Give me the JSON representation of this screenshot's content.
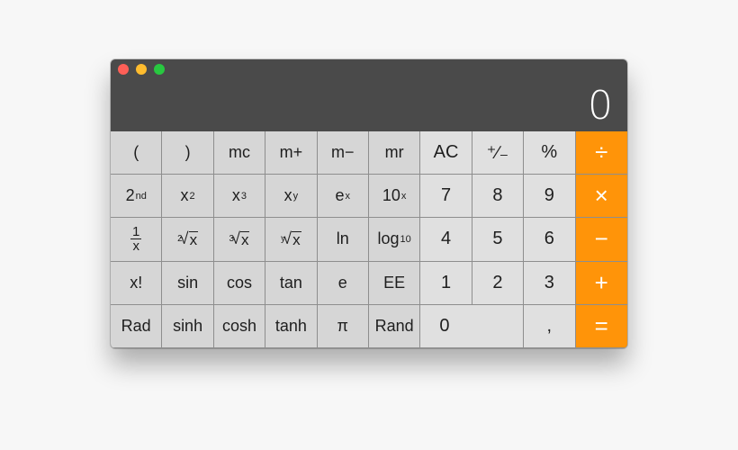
{
  "window": {
    "traffic_lights": [
      "close",
      "minimize",
      "zoom"
    ]
  },
  "display": {
    "value": "0"
  },
  "colors": {
    "operator": "#ff9409",
    "function_key": "#d6d6d6",
    "digit_key": "#e0e0e0",
    "display_bg": "#4a4a4a"
  },
  "keys": {
    "row1": {
      "open_paren": "(",
      "close_paren": ")",
      "mc": "mc",
      "m_plus": "m+",
      "m_minus": "m−",
      "mr": "mr",
      "ac": "AC",
      "sign": "⁺∕₋",
      "percent": "%",
      "divide": "÷"
    },
    "row2": {
      "second_base": "2",
      "second_sup": "nd",
      "x_squared_base": "x",
      "x_squared_sup": "2",
      "x_cubed_base": "x",
      "x_cubed_sup": "3",
      "x_pow_y_base": "x",
      "x_pow_y_sup": "y",
      "e_pow_x_base": "e",
      "e_pow_x_sup": "x",
      "ten_pow_x_base": "10",
      "ten_pow_x_sup": "x",
      "seven": "7",
      "eight": "8",
      "nine": "9",
      "multiply": "×"
    },
    "row3": {
      "reciprocal_num": "1",
      "reciprocal_den": "x",
      "sqrt2_index": "2",
      "sqrt2_symbol": "√",
      "sqrt2_radicand": "x",
      "sqrt3_index": "3",
      "sqrt3_symbol": "√",
      "sqrt3_radicand": "x",
      "sqrty_index": "y",
      "sqrty_symbol": "√",
      "sqrty_radicand": "x",
      "ln": "ln",
      "log10_base": "log",
      "log10_sub": "10",
      "four": "4",
      "five": "5",
      "six": "6",
      "minus": "−"
    },
    "row4": {
      "factorial": "x!",
      "sin": "sin",
      "cos": "cos",
      "tan": "tan",
      "e": "e",
      "ee": "EE",
      "one": "1",
      "two": "2",
      "three": "3",
      "plus": "+"
    },
    "row5": {
      "rad": "Rad",
      "sinh": "sinh",
      "cosh": "cosh",
      "tanh": "tanh",
      "pi": "π",
      "rand": "Rand",
      "zero": "0",
      "decimal": ",",
      "equals": "="
    }
  }
}
